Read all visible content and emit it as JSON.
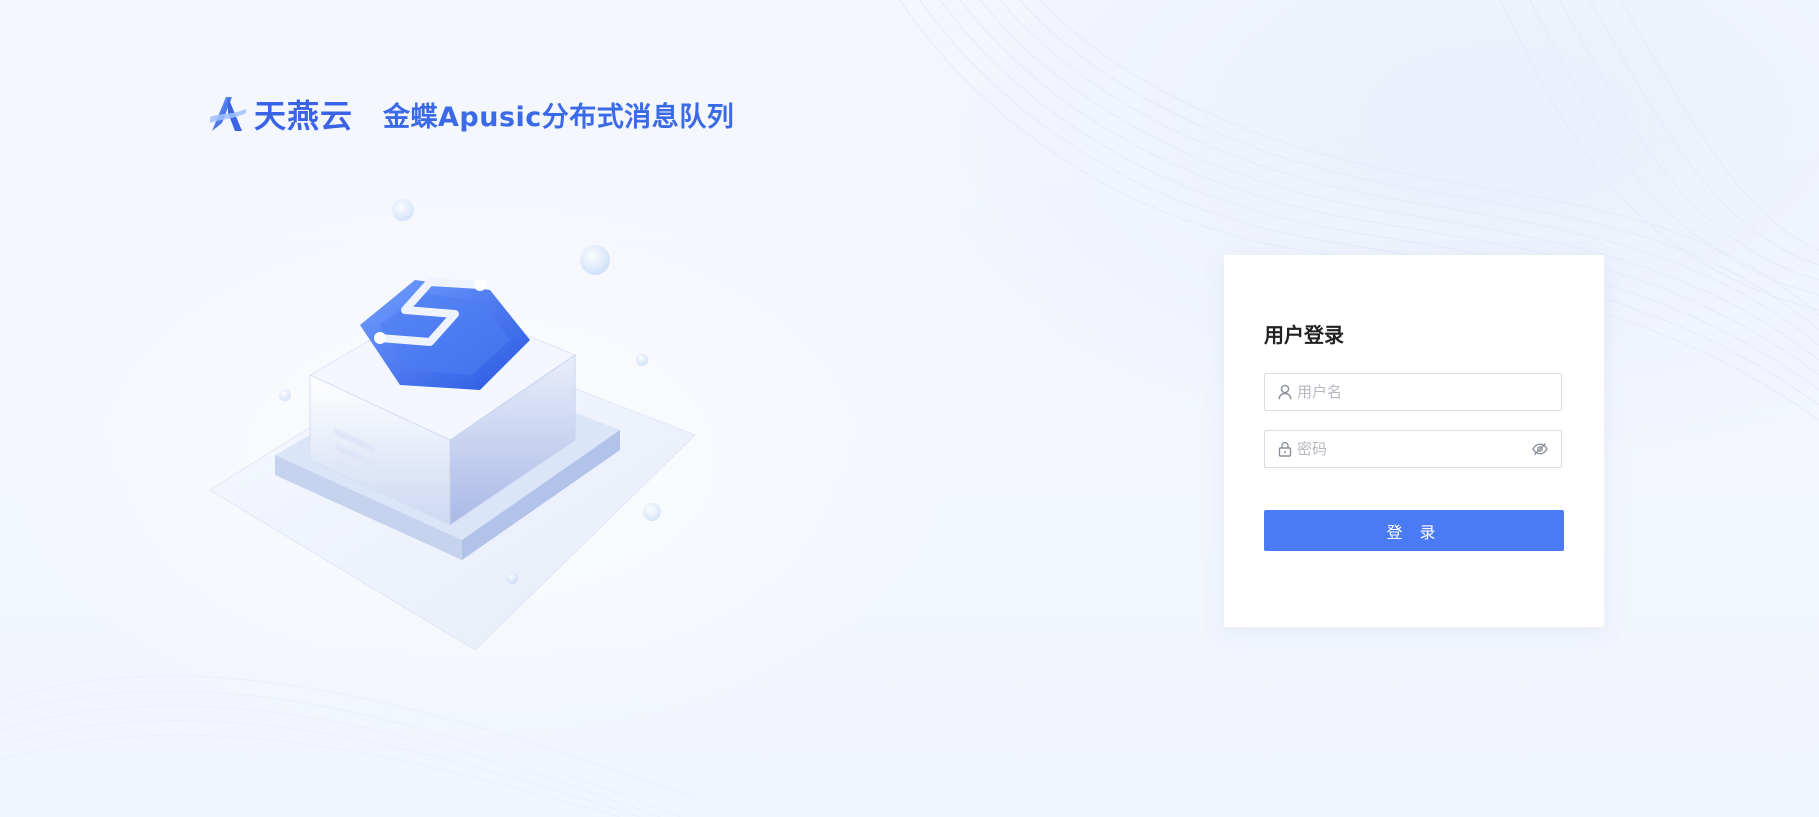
{
  "brand": {
    "name": "天燕云",
    "product_title": "金蝶Apusic分布式消息队列"
  },
  "login": {
    "title": "用户登录",
    "username": {
      "value": "",
      "placeholder": "用户名"
    },
    "password": {
      "value": "",
      "placeholder": "密码"
    },
    "submit_label": "登 录"
  },
  "colors": {
    "accent": "#4a7bf5",
    "brand": "#3a63e6",
    "background": "#f3f6fd"
  },
  "icons": {
    "username": "user-icon",
    "password": "lock-icon",
    "visibility": "eye-hidden-icon"
  }
}
